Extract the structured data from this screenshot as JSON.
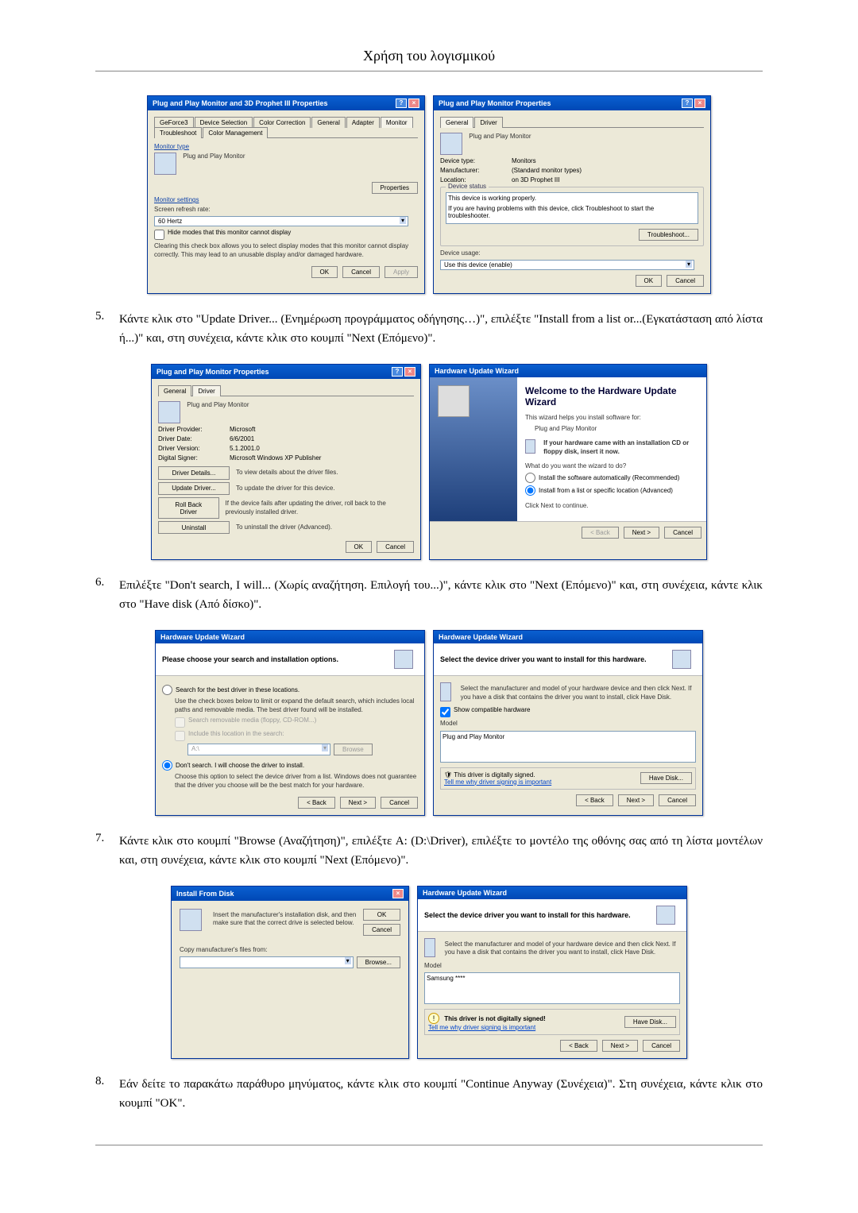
{
  "header": {
    "title": "Χρήση του λογισμικού"
  },
  "steps": {
    "5": {
      "num": "5.",
      "text": "Κάντε κλικ στο \"Update Driver... (Ενημέρωση προγράμματος οδήγησης…)\", επιλέξτε \"Install from a list or...(Εγκατάσταση από λίστα ή...)\" και, στη συνέχεια, κάντε κλικ στο κουμπί \"Next (Επόμενο)\"."
    },
    "6": {
      "num": "6.",
      "text": "Επιλέξτε \"Don't search, I will... (Χωρίς αναζήτηση. Επιλογή του...)\", κάντε κλικ στο \"Next (Επόμενο)\" και, στη συνέχεια, κάντε κλικ στο \"Have disk (Από δίσκο)\"."
    },
    "7": {
      "num": "7.",
      "text": "Κάντε κλικ στο κουμπί \"Browse (Αναζήτηση)\", επιλέξτε A: (D:\\Driver), επιλέξτε το μοντέλο της οθόνης σας από τη λίστα μοντέλων και, στη συνέχεια, κάντε κλικ στο κουμπί \"Next (Επόμενο)\"."
    },
    "8": {
      "num": "8.",
      "text": "Εάν δείτε το παρακάτω παράθυρο μηνύματος, κάντε κλικ στο κουμπί \"Continue Anyway (Συνέχεια)\". Στη συνέχεια, κάντε κλικ στο κουμπί \"OK\"."
    }
  },
  "dlg1a": {
    "title": "Plug and Play Monitor and 3D Prophet III Properties",
    "tabs": [
      "GeForce3",
      "Device Selection",
      "Color Correction",
      "General",
      "Adapter",
      "Monitor",
      "Troubleshoot",
      "Color Management"
    ],
    "monitor_type_label": "Monitor type",
    "monitor_type": "Plug and Play Monitor",
    "properties_btn": "Properties",
    "settings_label": "Monitor settings",
    "refresh_label": "Screen refresh rate:",
    "refresh_value": "60 Hertz",
    "hide_modes": "Hide modes that this monitor cannot display",
    "hide_desc": "Clearing this check box allows you to select display modes that this monitor cannot display correctly. This may lead to an unusable display and/or damaged hardware.",
    "ok": "OK",
    "cancel": "Cancel",
    "apply": "Apply"
  },
  "dlg1b": {
    "title": "Plug and Play Monitor Properties",
    "tab_general": "General",
    "tab_driver": "Driver",
    "pnp": "Plug and Play Monitor",
    "devtype_lbl": "Device type:",
    "devtype": "Monitors",
    "mfr_lbl": "Manufacturer:",
    "mfr": "(Standard monitor types)",
    "loc_lbl": "Location:",
    "loc": "on 3D Prophet III",
    "status_label": "Device status",
    "status": "This device is working properly.",
    "status_help": "If you are having problems with this device, click Troubleshoot to start the troubleshooter.",
    "troubleshoot": "Troubleshoot...",
    "usage_lbl": "Device usage:",
    "usage": "Use this device (enable)",
    "ok": "OK",
    "cancel": "Cancel"
  },
  "dlg2a": {
    "title": "Plug and Play Monitor Properties",
    "tab_general": "General",
    "tab_driver": "Driver",
    "pnp": "Plug and Play Monitor",
    "provider_lbl": "Driver Provider:",
    "provider": "Microsoft",
    "date_lbl": "Driver Date:",
    "date": "6/6/2001",
    "version_lbl": "Driver Version:",
    "version": "5.1.2001.0",
    "signer_lbl": "Digital Signer:",
    "signer": "Microsoft Windows XP Publisher",
    "btn_details": "Driver Details...",
    "btn_details_desc": "To view details about the driver files.",
    "btn_update": "Update Driver...",
    "btn_update_desc": "To update the driver for this device.",
    "btn_rollback": "Roll Back Driver",
    "btn_rollback_desc": "If the device fails after updating the driver, roll back to the previously installed driver.",
    "btn_uninstall": "Uninstall",
    "btn_uninstall_desc": "To uninstall the driver (Advanced).",
    "ok": "OK",
    "cancel": "Cancel"
  },
  "dlg2b": {
    "title": "Hardware Update Wizard",
    "welcome": "Welcome to the Hardware Update Wizard",
    "helps": "This wizard helps you install software for:",
    "device": "Plug and Play Monitor",
    "cd_hint": "If your hardware came with an installation CD or floppy disk, insert it now.",
    "what": "What do you want the wizard to do?",
    "opt1": "Install the software automatically (Recommended)",
    "opt2": "Install from a list or specific location (Advanced)",
    "continue": "Click Next to continue.",
    "back": "< Back",
    "next": "Next >",
    "cancel": "Cancel"
  },
  "dlg3a": {
    "title": "Hardware Update Wizard",
    "heading": "Please choose your search and installation options.",
    "opt_search": "Search for the best driver in these locations.",
    "opt_search_desc": "Use the check boxes below to limit or expand the default search, which includes local paths and removable media. The best driver found will be installed.",
    "chk1": "Search removable media (floppy, CD-ROM...)",
    "chk2": "Include this location in the search:",
    "path": "A:\\",
    "browse": "Browse",
    "opt_dont": "Don't search. I will choose the driver to install.",
    "opt_dont_desc": "Choose this option to select the device driver from a list. Windows does not guarantee that the driver you choose will be the best match for your hardware.",
    "back": "< Back",
    "next": "Next >",
    "cancel": "Cancel"
  },
  "dlg3b": {
    "title": "Hardware Update Wizard",
    "heading": "Select the device driver you want to install for this hardware.",
    "desc": "Select the manufacturer and model of your hardware device and then click Next. If you have a disk that contains the driver you want to install, click Have Disk.",
    "show_compat": "Show compatible hardware",
    "model_lbl": "Model",
    "model": "Plug and Play Monitor",
    "signed": "This driver is digitally signed.",
    "tell_me": "Tell me why driver signing is important",
    "have_disk": "Have Disk...",
    "back": "< Back",
    "next": "Next >",
    "cancel": "Cancel"
  },
  "dlg4a": {
    "title": "Install From Disk",
    "desc": "Insert the manufacturer's installation disk, and then make sure that the correct drive is selected below.",
    "ok": "OK",
    "cancel": "Cancel",
    "copy_lbl": "Copy manufacturer's files from:",
    "path": "",
    "browse": "Browse..."
  },
  "dlg4b": {
    "title": "Hardware Update Wizard",
    "heading": "Select the device driver you want to install for this hardware.",
    "desc": "Select the manufacturer and model of your hardware device and then click Next. If you have a disk that contains the driver you want to install, click Have Disk.",
    "model_lbl": "Model",
    "model": "Samsung ****",
    "not_signed": "This driver is not digitally signed!",
    "tell_me": "Tell me why driver signing is important",
    "have_disk": "Have Disk...",
    "back": "< Back",
    "next": "Next >",
    "cancel": "Cancel"
  }
}
